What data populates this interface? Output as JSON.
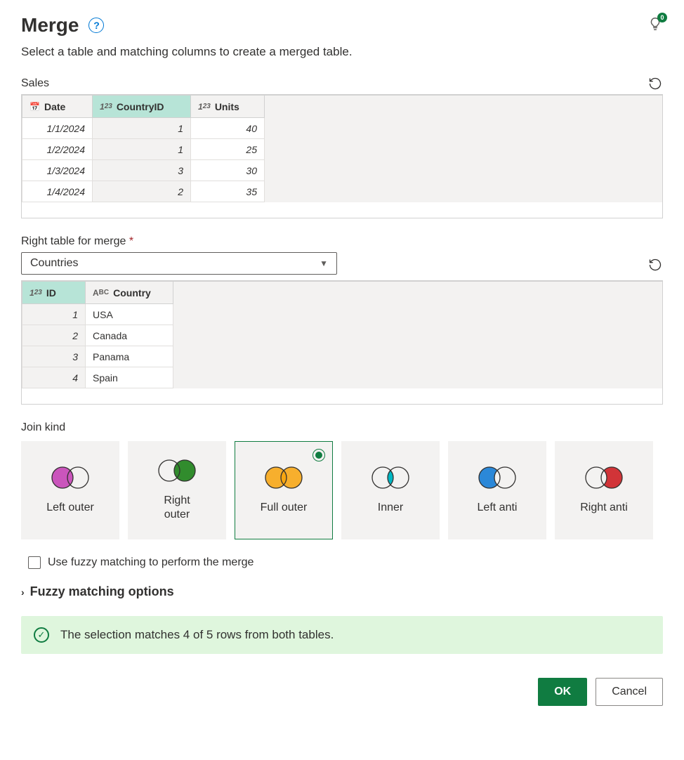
{
  "header": {
    "title": "Merge",
    "help_aria": "?",
    "bulb_count": "0",
    "subtitle": "Select a table and matching columns to create a merged table."
  },
  "tables": {
    "left": {
      "label": "Sales",
      "columns": [
        {
          "name": "Date",
          "type": "date",
          "selected": false
        },
        {
          "name": "CountryID",
          "type": "number",
          "selected": true
        },
        {
          "name": "Units",
          "type": "number",
          "selected": false
        }
      ],
      "rows": [
        [
          "1/1/2024",
          "1",
          "40"
        ],
        [
          "1/2/2024",
          "1",
          "25"
        ],
        [
          "1/3/2024",
          "3",
          "30"
        ],
        [
          "1/4/2024",
          "2",
          "35"
        ]
      ]
    },
    "right": {
      "field_label": "Right table for merge",
      "dropdown_value": "Countries",
      "columns": [
        {
          "name": "ID",
          "type": "number",
          "selected": true
        },
        {
          "name": "Country",
          "type": "text",
          "selected": false
        }
      ],
      "rows": [
        [
          "1",
          "USA"
        ],
        [
          "2",
          "Canada"
        ],
        [
          "3",
          "Panama"
        ],
        [
          "4",
          "Spain"
        ]
      ]
    }
  },
  "join": {
    "label": "Join kind",
    "options": [
      {
        "name": "Left outer"
      },
      {
        "name": "Right outer"
      },
      {
        "name": "Full outer"
      },
      {
        "name": "Inner"
      },
      {
        "name": "Left anti"
      },
      {
        "name": "Right anti"
      }
    ],
    "selected_index": 2
  },
  "fuzzy": {
    "checkbox_label": "Use fuzzy matching to perform the merge",
    "options_label": "Fuzzy matching options"
  },
  "status": {
    "message": "The selection matches 4 of 5 rows from both tables."
  },
  "buttons": {
    "ok": "OK",
    "cancel": "Cancel"
  }
}
